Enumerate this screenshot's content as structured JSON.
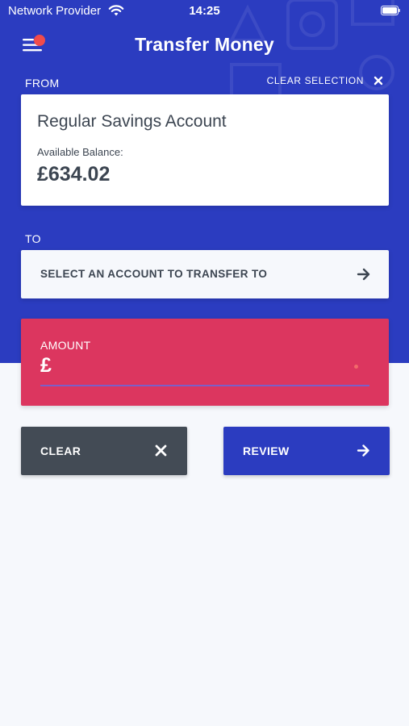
{
  "status_bar": {
    "carrier": "Network Provider",
    "time": "14:25"
  },
  "header": {
    "title": "Transfer Money",
    "menu_icon": "menu-notification-icon"
  },
  "from": {
    "label": "FROM",
    "clear_selection": "CLEAR SELECTION",
    "account_name": "Regular Savings Account",
    "balance_label": "Available Balance:",
    "balance_value": "£634.02"
  },
  "to": {
    "label": "TO",
    "placeholder": "SELECT AN ACCOUNT TO TRANSFER TO"
  },
  "amount": {
    "label": "AMOUNT",
    "currency": "£",
    "value": ""
  },
  "actions": {
    "clear_label": "CLEAR",
    "review_label": "REVIEW"
  },
  "colors": {
    "primary": "#2b3cc0",
    "accent_red": "#dc365f",
    "dark_button": "#434b55",
    "text_dark": "#3c4551",
    "background": "#f6f8fc"
  }
}
